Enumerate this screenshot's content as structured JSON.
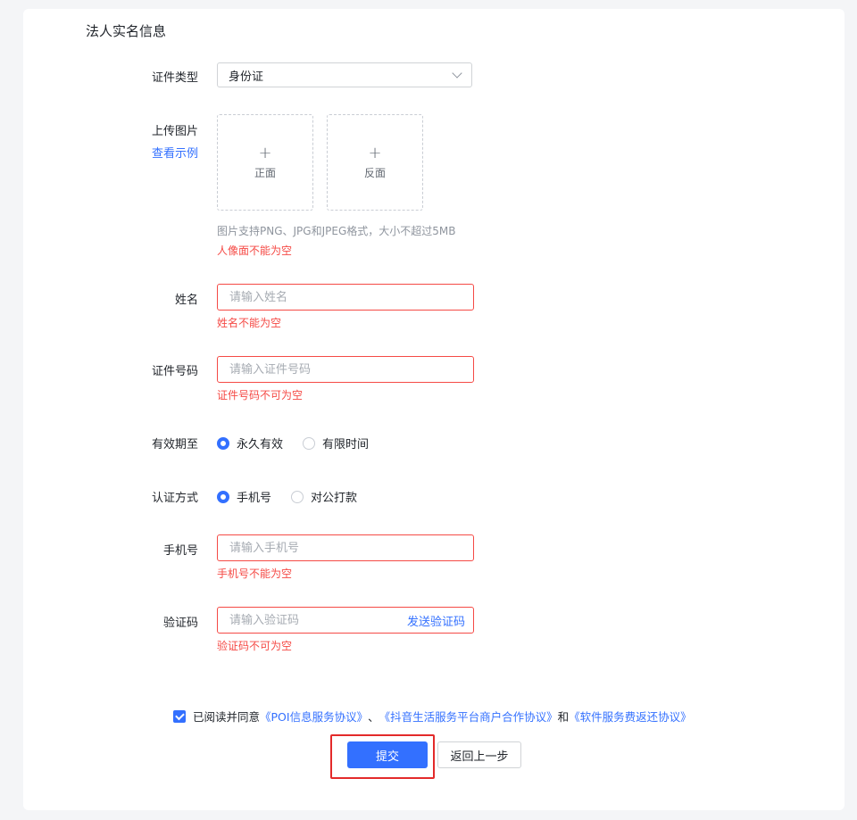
{
  "section_title": "法人实名信息",
  "id_type": {
    "label": "证件类型",
    "value": "身份证"
  },
  "upload": {
    "label": "上传图片",
    "example_link": "查看示例",
    "front_label": "正面",
    "back_label": "反面",
    "plus": "+",
    "hint": "图片支持PNG、JPG和JPEG格式，大小不超过5MB",
    "error": "人像面不能为空"
  },
  "name": {
    "label": "姓名",
    "placeholder": "请输入姓名",
    "error": "姓名不能为空"
  },
  "id_number": {
    "label": "证件号码",
    "placeholder": "请输入证件号码",
    "error": "证件号码不可为空"
  },
  "validity": {
    "label": "有效期至",
    "options": [
      "永久有效",
      "有限时间"
    ],
    "selected": 0
  },
  "auth_method": {
    "label": "认证方式",
    "options": [
      "手机号",
      "对公打款"
    ],
    "selected": 0
  },
  "phone": {
    "label": "手机号",
    "placeholder": "请输入手机号",
    "error": "手机号不能为空"
  },
  "code": {
    "label": "验证码",
    "placeholder": "请输入验证码",
    "send_label": "发送验证码",
    "error": "验证码不可为空"
  },
  "agreement": {
    "checked": true,
    "prefix": "已阅读并同意",
    "doc1": "《POI信息服务协议》",
    "sep": "、",
    "doc2": "《抖音生活服务平台商户合作协议》",
    "and": "和",
    "doc3": "《软件服务费返还协议》"
  },
  "buttons": {
    "submit": "提交",
    "back": "返回上一步"
  },
  "colors": {
    "primary": "#3370ff",
    "error": "#f54a45",
    "highlight": "#e32a2a"
  }
}
